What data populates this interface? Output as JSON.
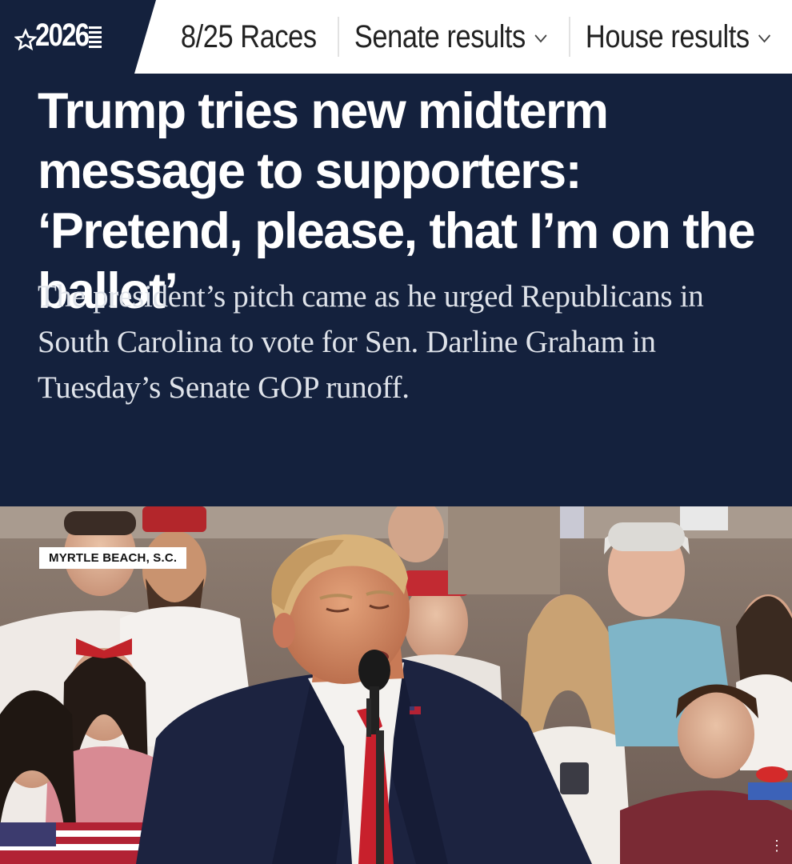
{
  "brand": {
    "logo_text": "2026"
  },
  "nav": {
    "items": [
      {
        "label": "8/25 Races",
        "has_dropdown": false
      },
      {
        "label": "Senate results",
        "has_dropdown": true
      },
      {
        "label": "House results",
        "has_dropdown": true
      }
    ]
  },
  "article": {
    "headline": "Trump tries new midterm message to supporters: ‘Pretend, please, that I’m on the ballot’",
    "dek": "The president’s pitch came as he urged Republicans in South Carolina to vote for Sen. Darline Graham in Tuesday’s Senate GOP runoff.",
    "photo": {
      "location_label": "MYRTLE BEACH, S.C."
    }
  },
  "colors": {
    "navy": "#14213d",
    "white": "#ffffff",
    "nav_text": "#222222",
    "dek_text": "#dfe3ea",
    "tie_red": "#c8202c"
  },
  "icons": {
    "star": "star-icon",
    "chevron": "chevron-down-icon"
  }
}
